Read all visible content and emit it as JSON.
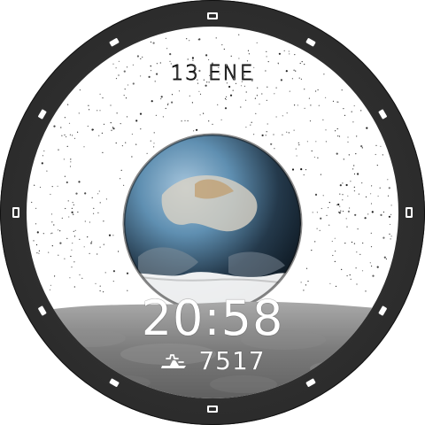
{
  "watchface": {
    "date_text": "13 ENE",
    "time_text": "20:58",
    "steps_text": "7517"
  },
  "icons": {
    "steps": "steps-icon"
  },
  "colors": {
    "bezel": "#2b2b2b",
    "tick": "#ffffff",
    "text": "#ffffff"
  }
}
